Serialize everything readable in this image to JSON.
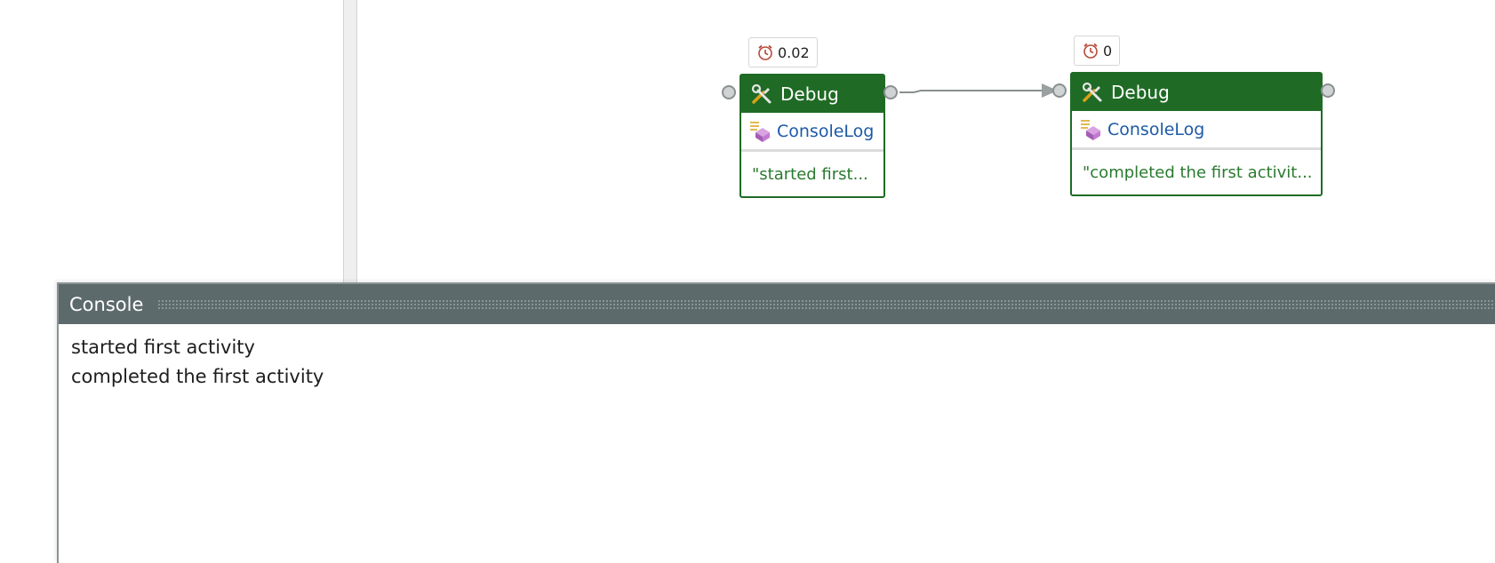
{
  "workflow": {
    "activities": [
      {
        "timer": "0.02",
        "type_label": "Debug",
        "method_label": "ConsoleLog",
        "argument": "\"started first..."
      },
      {
        "timer": "0",
        "type_label": "Debug",
        "method_label": "ConsoleLog",
        "argument": "\"completed the first activit..."
      }
    ]
  },
  "console": {
    "title": "Console",
    "lines": [
      "started first activity",
      "completed the first activity"
    ]
  },
  "icons": {
    "timer": "alarm-clock-icon",
    "debug": "wrench-screwdriver-icon",
    "console_log": "console-log-icon"
  },
  "colors": {
    "node_header": "#1f6b25",
    "method_link": "#1c5aa6",
    "argument_text": "#2a7a2f",
    "console_header": "#5d6a6c"
  }
}
